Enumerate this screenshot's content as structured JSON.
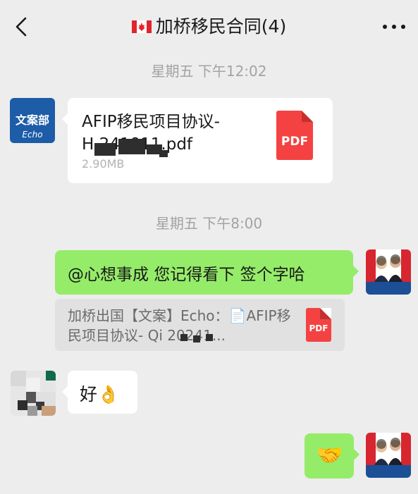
{
  "header": {
    "title": "加桥移民合同(4)",
    "flag_icon": "canada-flag-icon",
    "back_icon": "chevron-left-icon",
    "more_icon": "more-dots-icon"
  },
  "timestamps": [
    "星期五 下午12:02",
    "星期五 下午8:00"
  ],
  "messages": [
    {
      "sender_avatar": {
        "line1": "文案部",
        "line2": "Echo"
      },
      "file": {
        "name_line1": "AFIP移民项目协议-",
        "name_line2": "H         241011.pdf",
        "size": "2.90MB",
        "icon_label": "PDF"
      }
    },
    {
      "text": "@心想事成 您记得看下 签个字哈",
      "quote": {
        "line1": "加桥出国【文案】Echo：📄AFIP移",
        "line2": "民项目协议-          Qi 20241...",
        "icon_label": "PDF"
      }
    },
    {
      "text": "好👌"
    },
    {
      "emoji": "🤝"
    }
  ],
  "colors": {
    "background": "#ededed",
    "bubble_green": "#95ec69",
    "bubble_white": "#ffffff",
    "pdf_red": "#f44242"
  }
}
